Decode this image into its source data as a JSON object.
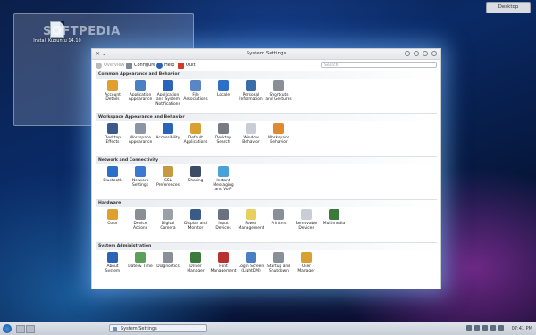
{
  "desktop": {
    "folder_icon_label": "Install Kubuntu 14.10",
    "watermark": "SOFTPEDIA",
    "desktop_button": "Desktop"
  },
  "window": {
    "title": "System Settings",
    "toolbar": {
      "overview": "Overview",
      "configure": "Configure",
      "help": "Help",
      "quit": "Quit"
    },
    "search_placeholder": "Search"
  },
  "sections": [
    {
      "title": "Common Appearance and Behavior",
      "items": [
        {
          "label": "Account\nDetails",
          "icon": "account-icon",
          "color": "#e0a030"
        },
        {
          "label": "Application\nAppearance",
          "icon": "appearance-icon",
          "color": "#4a7fc1"
        },
        {
          "label": "Application\nand System\nNotifications",
          "icon": "notifications-icon",
          "color": "#2a63b8"
        },
        {
          "label": "File\nAssociations",
          "icon": "file-associations-icon",
          "color": "#5a86c5"
        },
        {
          "label": "Locale",
          "icon": "locale-icon",
          "color": "#2f6fc7"
        },
        {
          "label": "Personal\nInformation",
          "icon": "personal-info-icon",
          "color": "#3a6ea8"
        },
        {
          "label": "Shortcuts\nand Gestures",
          "icon": "shortcuts-icon",
          "color": "#8a8f96"
        }
      ]
    },
    {
      "title": "Workspace Appearance and Behavior",
      "items": [
        {
          "label": "Desktop\nEffects",
          "icon": "desktop-effects-icon",
          "color": "#3a5a8a"
        },
        {
          "label": "Workspace\nAppearance",
          "icon": "workspace-appearance-icon",
          "color": "#8a96a6"
        },
        {
          "label": "Accessibility",
          "icon": "accessibility-icon",
          "color": "#2a63b8"
        },
        {
          "label": "Default\nApplications",
          "icon": "default-apps-icon",
          "color": "#d8a030"
        },
        {
          "label": "Desktop\nSearch",
          "icon": "desktop-search-icon",
          "color": "#777c84"
        },
        {
          "label": "Window\nBehavior",
          "icon": "window-behavior-icon",
          "color": "#c9ced6"
        },
        {
          "label": "Workspace\nBehavior",
          "icon": "workspace-behavior-icon",
          "color": "#e08a30"
        }
      ]
    },
    {
      "title": "Network and Connectivity",
      "items": [
        {
          "label": "Bluetooth",
          "icon": "bluetooth-icon",
          "color": "#2a6fc9"
        },
        {
          "label": "Network\nSettings",
          "icon": "network-icon",
          "color": "#3a7ad0"
        },
        {
          "label": "SSL\nPreferences",
          "icon": "ssl-icon",
          "color": "#c89a40"
        },
        {
          "label": "Sharing",
          "icon": "sharing-icon",
          "color": "#3c4c66"
        },
        {
          "label": "Instant\nMessaging\nand VoIP",
          "icon": "messaging-icon",
          "color": "#4aa0d8"
        }
      ]
    },
    {
      "title": "Hardware",
      "items": [
        {
          "label": "Color",
          "icon": "color-icon",
          "color": "#e0a030"
        },
        {
          "label": "Device\nActions",
          "icon": "device-actions-icon",
          "color": "#8a8f96"
        },
        {
          "label": "Digital\nCamera",
          "icon": "camera-icon",
          "color": "#9aa0a8"
        },
        {
          "label": "Display and\nMonitor",
          "icon": "display-icon",
          "color": "#3a5a8a"
        },
        {
          "label": "Input\nDevices",
          "icon": "input-devices-icon",
          "color": "#6a7280"
        },
        {
          "label": "Power\nManagement",
          "icon": "power-icon",
          "color": "#e8d060"
        },
        {
          "label": "Printers",
          "icon": "printer-icon",
          "color": "#8a9098"
        },
        {
          "label": "Removable\nDevices",
          "icon": "removable-devices-icon",
          "color": "#c9ced6"
        },
        {
          "label": "Multimedia",
          "icon": "multimedia-icon",
          "color": "#3a7a3a"
        }
      ]
    },
    {
      "title": "System Administration",
      "items": [
        {
          "label": "About\nSystem",
          "icon": "about-icon",
          "color": "#2a63b8"
        },
        {
          "label": "Date & Time",
          "icon": "clock-icon",
          "color": "#5aa05a"
        },
        {
          "label": "Diagnostics",
          "icon": "diagnostics-icon",
          "color": "#8a9098"
        },
        {
          "label": "Driver\nManager",
          "icon": "driver-icon",
          "color": "#3a7a3a"
        },
        {
          "label": "Font\nManagement",
          "icon": "font-icon",
          "color": "#b83030"
        },
        {
          "label": "Login Screen\n(LightDM)",
          "icon": "login-screen-icon",
          "color": "#4a7fc1"
        },
        {
          "label": "Startup and\nShutdown",
          "icon": "startup-icon",
          "color": "#8a9098"
        },
        {
          "label": "User\nManager",
          "icon": "user-manager-icon",
          "color": "#d8a030"
        }
      ]
    }
  ],
  "taskbar": {
    "task_label": "System Settings",
    "clock": "07:41 PM"
  }
}
